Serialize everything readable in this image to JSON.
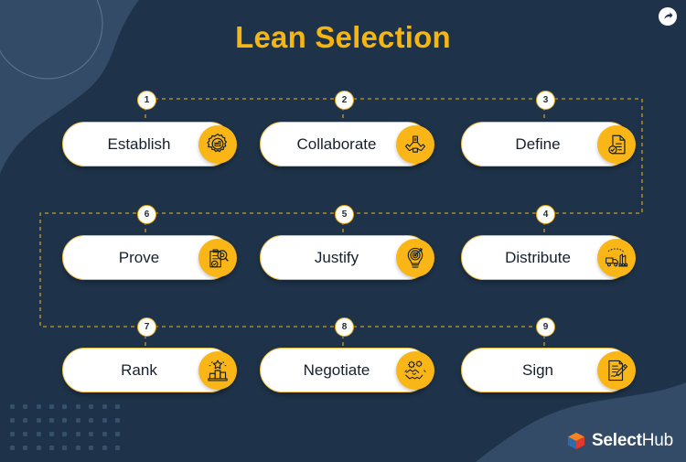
{
  "page": {
    "title": "Lean Selection",
    "background_color": "#1e3349",
    "accent_color": "#f9b616",
    "title_color": "#f5b612",
    "card_bg": "#ffffff",
    "card_text_color": "#16202c",
    "connector_color": "#c79a2a"
  },
  "share_button": {
    "name": "share",
    "glyph": "share-arrow"
  },
  "steps": [
    {
      "number": "1",
      "label": "Establish",
      "icon": "badge-seal-factory-icon",
      "row": 1,
      "col": 1
    },
    {
      "number": "2",
      "label": "Collaborate",
      "icon": "hands-collaborate-icon",
      "row": 1,
      "col": 2
    },
    {
      "number": "3",
      "label": "Define",
      "icon": "document-check-icon",
      "row": 1,
      "col": 3
    },
    {
      "number": "4",
      "label": "Distribute",
      "icon": "truck-factory-icon",
      "row": 2,
      "col": 3
    },
    {
      "number": "5",
      "label": "Justify",
      "icon": "lightbulb-target-icon",
      "row": 2,
      "col": 2
    },
    {
      "number": "6",
      "label": "Prove",
      "icon": "clipboard-search-icon",
      "row": 2,
      "col": 1
    },
    {
      "number": "7",
      "label": "Rank",
      "icon": "podium-star-icon",
      "row": 3,
      "col": 1
    },
    {
      "number": "8",
      "label": "Negotiate",
      "icon": "handshake-gears-icon",
      "row": 3,
      "col": 2
    },
    {
      "number": "9",
      "label": "Sign",
      "icon": "document-pen-icon",
      "row": 3,
      "col": 3
    }
  ],
  "logo": {
    "brand_primary": "Select",
    "brand_secondary": "Hub",
    "mark": "cube-logo-icon"
  }
}
